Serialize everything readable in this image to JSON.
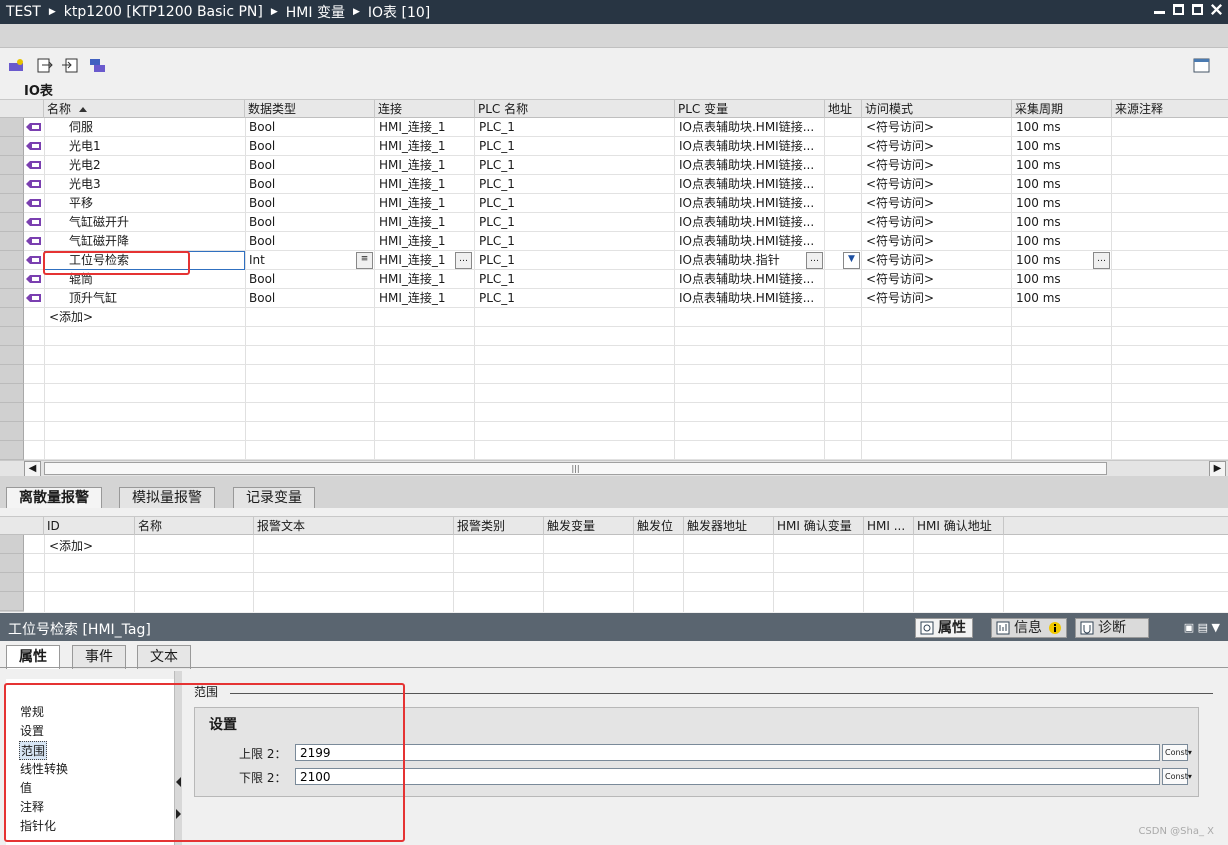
{
  "breadcrumb": [
    "TEST",
    "ktp1200 [KTP1200 Basic PN]",
    "HMI 变量",
    "IO表 [10]"
  ],
  "table_title": "IO表",
  "columns": [
    "名称",
    "数据类型",
    "连接",
    "PLC 名称",
    "PLC 变量",
    "地址",
    "访问模式",
    "采集周期",
    "来源注释"
  ],
  "rows": [
    {
      "name": "伺服",
      "type": "Bool",
      "conn": "HMI_连接_1",
      "plc": "PLC_1",
      "var": "IO点表辅助块.HMI链接...",
      "addr": "",
      "mode": "<符号访问>",
      "cycle": "100 ms"
    },
    {
      "name": "光电1",
      "type": "Bool",
      "conn": "HMI_连接_1",
      "plc": "PLC_1",
      "var": "IO点表辅助块.HMI链接...",
      "addr": "",
      "mode": "<符号访问>",
      "cycle": "100 ms"
    },
    {
      "name": "光电2",
      "type": "Bool",
      "conn": "HMI_连接_1",
      "plc": "PLC_1",
      "var": "IO点表辅助块.HMI链接...",
      "addr": "",
      "mode": "<符号访问>",
      "cycle": "100 ms"
    },
    {
      "name": "光电3",
      "type": "Bool",
      "conn": "HMI_连接_1",
      "plc": "PLC_1",
      "var": "IO点表辅助块.HMI链接...",
      "addr": "",
      "mode": "<符号访问>",
      "cycle": "100 ms"
    },
    {
      "name": "平移",
      "type": "Bool",
      "conn": "HMI_连接_1",
      "plc": "PLC_1",
      "var": "IO点表辅助块.HMI链接...",
      "addr": "",
      "mode": "<符号访问>",
      "cycle": "100 ms"
    },
    {
      "name": "气缸磁开升",
      "type": "Bool",
      "conn": "HMI_连接_1",
      "plc": "PLC_1",
      "var": "IO点表辅助块.HMI链接...",
      "addr": "",
      "mode": "<符号访问>",
      "cycle": "100 ms"
    },
    {
      "name": "气缸磁开降",
      "type": "Bool",
      "conn": "HMI_连接_1",
      "plc": "PLC_1",
      "var": "IO点表辅助块.HMI链接...",
      "addr": "",
      "mode": "<符号访问>",
      "cycle": "100 ms"
    },
    {
      "name": "工位号检索",
      "type": "Int",
      "conn": "HMI_连接_1",
      "plc": "PLC_1",
      "var": "IO点表辅助块.指针",
      "addr": "",
      "mode": "<符号访问>",
      "cycle": "100 ms"
    },
    {
      "name": "辊筒",
      "type": "Bool",
      "conn": "HMI_连接_1",
      "plc": "PLC_1",
      "var": "IO点表辅助块.HMI链接...",
      "addr": "",
      "mode": "<符号访问>",
      "cycle": "100 ms"
    },
    {
      "name": "顶升气缸",
      "type": "Bool",
      "conn": "HMI_连接_1",
      "plc": "PLC_1",
      "var": "IO点表辅助块.HMI链接...",
      "addr": "",
      "mode": "<符号访问>",
      "cycle": "100 ms"
    }
  ],
  "add_row_label": "<添加>",
  "alarm_tabs": [
    "离散量报警",
    "模拟量报警",
    "记录变量"
  ],
  "alarm_columns": [
    "ID",
    "名称",
    "报警文本",
    "报警类别",
    "触发变量",
    "触发位",
    "触发器地址",
    "HMI 确认变量",
    "HMI ...",
    "HMI 确认地址"
  ],
  "alarm_add_label": "<添加>",
  "inspector": {
    "title": "工位号检索 [HMI_Tag]",
    "tabs": [
      "属性",
      "信息",
      "诊断"
    ],
    "prop_tabs": [
      "属性",
      "事件",
      "文本"
    ],
    "nav": [
      "常规",
      "设置",
      "范围",
      "线性转换",
      "值",
      "注释",
      "指针化"
    ],
    "selected_nav": "范围",
    "section": "范围",
    "settings_title": "设置",
    "upper_label": "上限 2：",
    "upper_value": "2199",
    "lower_label": "下限 2：",
    "lower_value": "2100",
    "const_label": "Const"
  },
  "watermark": "CSDN @Sha_ X"
}
